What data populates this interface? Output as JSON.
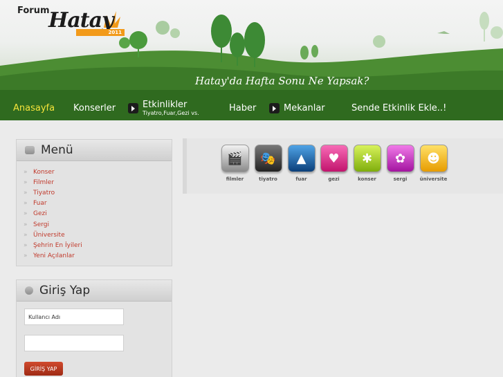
{
  "logo": {
    "forum": "Forum",
    "name": "Hatay",
    "year": "2011"
  },
  "slogan": "Hatay'da Hafta Sonu Ne Yapsak?",
  "nav": [
    {
      "label": "Anasayfa"
    },
    {
      "label": "Konserler"
    },
    {
      "label": "Etkinlikler",
      "sub": "Tiyatro,Fuar,Gezi vs."
    },
    {
      "label": "Haber"
    },
    {
      "label": "Mekanlar"
    },
    {
      "label": "Sende Etkinlik Ekle..!"
    }
  ],
  "menu": {
    "title": "Menü",
    "items": [
      "Konser",
      "Filmler",
      "Tiyatro",
      "Fuar",
      "Gezi",
      "Sergi",
      "Üniversite",
      "Şehrin En İyileri",
      "Yeni Açılanlar"
    ]
  },
  "login": {
    "title": "Giriş Yap",
    "username_value": "Kullancı Adı",
    "password_value": "",
    "button": "GİRİŞ YAP"
  },
  "categories": [
    {
      "label": "filmler",
      "icon": "clapperboard-icon",
      "color": "#2a2a2a"
    },
    {
      "label": "tiyatro",
      "icon": "theater-masks-icon",
      "color": "#3a3a3a"
    },
    {
      "label": "fuar",
      "icon": "landscape-icon",
      "color": "#1a6fb5"
    },
    {
      "label": "gezi",
      "icon": "couple-icon",
      "color": "#e0388a"
    },
    {
      "label": "konser",
      "icon": "person-jumping-icon",
      "color": "#a8d41e"
    },
    {
      "label": "sergi",
      "icon": "flower-frame-icon",
      "color": "#d33ac8"
    },
    {
      "label": "üniversite",
      "icon": "speaking-person-icon",
      "color": "#f5b800"
    }
  ]
}
